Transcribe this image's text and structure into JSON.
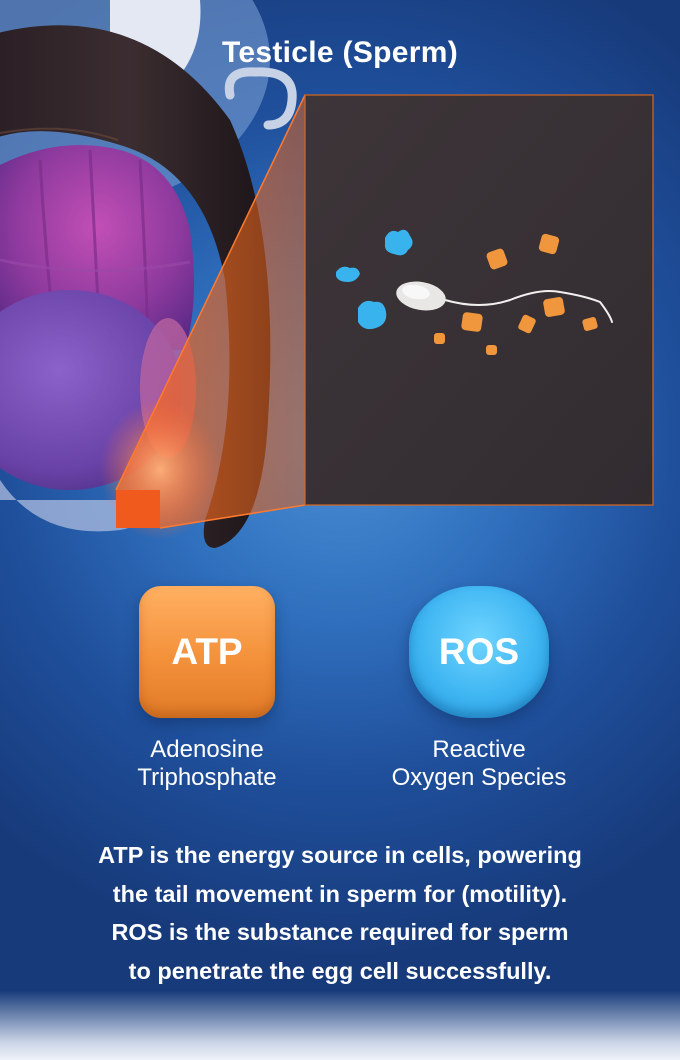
{
  "title": "Testicle (Sperm)",
  "legend": {
    "atp": {
      "symbol": "ATP",
      "name_line1": "Adenosine",
      "name_line2": "Triphosphate",
      "color": "#f4913b"
    },
    "ros": {
      "symbol": "ROS",
      "name_line1": "Reactive",
      "name_line2": "Oxygen Species",
      "color": "#3fb6f2"
    }
  },
  "caption": {
    "line1": "ATP is the energy source in cells, powering",
    "line2": "the tail movement in sperm for (motility).",
    "line3": "ROS is the substance required for sperm",
    "line4": "to penetrate the egg cell successfully."
  },
  "colors": {
    "background": "#2f6fbd",
    "zoom_panel": "#3a3438",
    "highlight": "#f05a1c"
  }
}
